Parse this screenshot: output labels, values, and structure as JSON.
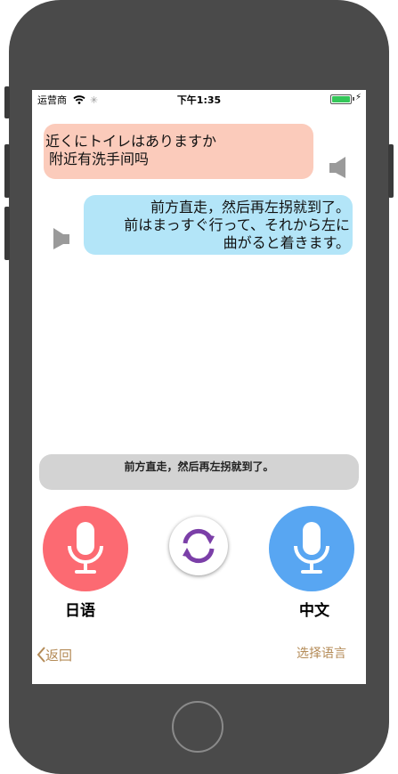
{
  "status_bar": {
    "carrier": "运营商",
    "time": "下午1:35",
    "battery_percent": 100
  },
  "messages": [
    {
      "side": "left",
      "lines": [
        "近くにトイレはありますか",
        "附近有洗手间吗"
      ]
    },
    {
      "side": "right",
      "lines": [
        "前方直走，然后再左拐就到了。",
        "前はまっすぐ行って、それから左に",
        "曲がると着きます。"
      ]
    }
  ],
  "result_text": "前方直走，然后再左拐就到了。",
  "languages": {
    "left": "日语",
    "right": "中文"
  },
  "nav": {
    "back": "返回",
    "select_language": "选择语言"
  },
  "colors": {
    "left_bubble": "#fbcbbb",
    "right_bubble": "#b3e5f8",
    "left_mic": "#fc6a72",
    "right_mic": "#58a6f2",
    "swap_icon": "#7b3fa8",
    "nav_text": "#b48b57"
  },
  "icons": {
    "left_speaker": "speaker-icon",
    "right_speaker": "speaker-icon",
    "mic": "microphone-icon",
    "swap": "swap-languages-icon",
    "back": "chevron-left-icon",
    "wifi": "wifi-icon"
  }
}
